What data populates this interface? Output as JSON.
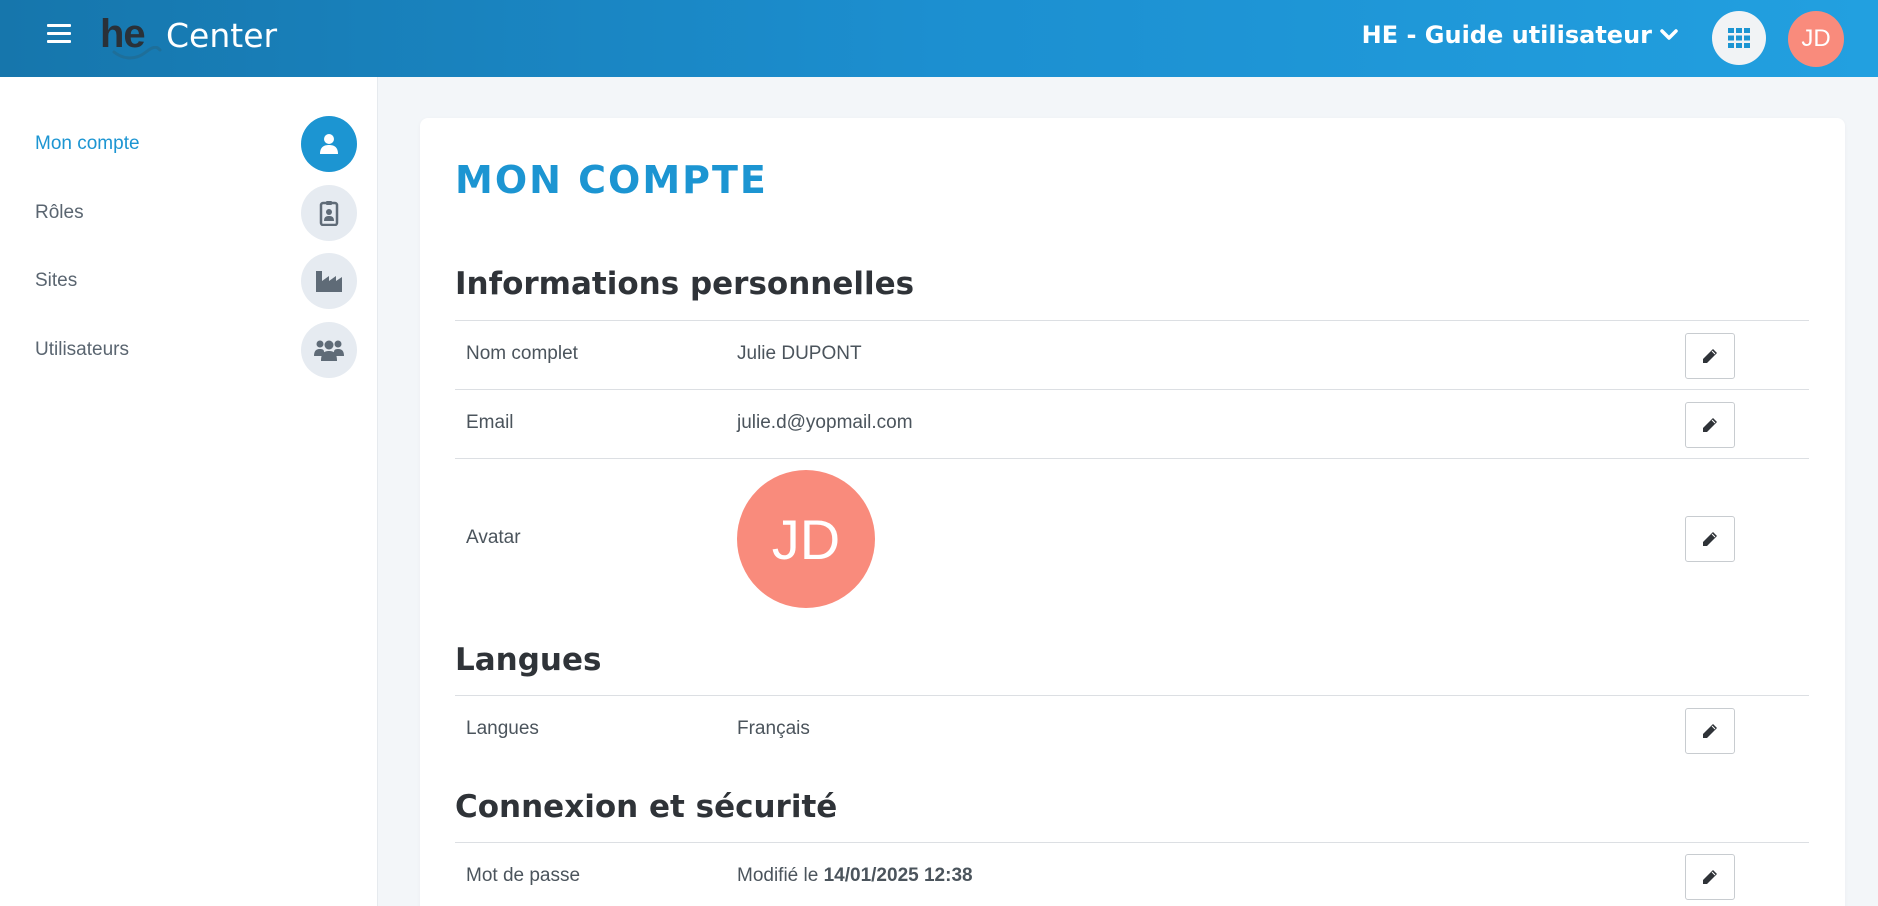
{
  "header": {
    "logo_mark": "he",
    "logo_text": "Center",
    "organization": "HE - Guide utilisateur",
    "user_initials": "JD"
  },
  "sidebar": {
    "items": [
      {
        "label": "Mon compte",
        "icon": "user-icon",
        "active": true
      },
      {
        "label": "Rôles",
        "icon": "badge-icon",
        "active": false
      },
      {
        "label": "Sites",
        "icon": "factory-icon",
        "active": false
      },
      {
        "label": "Utilisateurs",
        "icon": "users-icon",
        "active": false
      }
    ]
  },
  "main": {
    "page_title": "MON COMPTE",
    "personal": {
      "title": "Informations personnelles",
      "full_name_label": "Nom complet",
      "full_name_value": "Julie DUPONT",
      "email_label": "Email",
      "email_value": "julie.d@yopmail.com",
      "avatar_label": "Avatar",
      "avatar_initials": "JD"
    },
    "languages": {
      "title": "Langues",
      "label": "Langues",
      "value": "Français"
    },
    "security": {
      "title": "Connexion et sécurité",
      "password_label": "Mot de passe",
      "password_prefix": "Modifié le",
      "password_date": "14/01/2025 12:38"
    }
  },
  "colors": {
    "accent": "#1c95d2",
    "avatar": "#f98b7c",
    "header_start": "#1676ac",
    "header_end": "#22a0e0"
  }
}
